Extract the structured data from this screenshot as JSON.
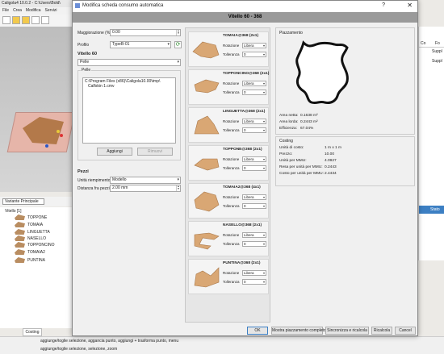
{
  "bg_app": {
    "title": "Caligola4 10.0.2 - C:\\Users\\Bold\\",
    "menu": [
      "File",
      "Crea",
      "Modifica",
      "Servizi"
    ],
    "variant_select": "Variante Principale",
    "tree_root": "Vitello [1]",
    "tree_items": [
      "TOPPONE",
      "TOMAIA",
      "LINGUETTA",
      "NASELLO",
      "TOPPONCINO",
      "TOMAIA2",
      "PUNTINA"
    ],
    "bottom_tab": "Costing",
    "status_lines": [
      "aggiunge/toglie selezione,  aggancia punto,  aggiungi + trasforma punto,  menu",
      "aggiunge/toglie selezione,  selezione,  zoom"
    ],
    "right_panel": {
      "header_cols": [
        "Co",
        "Fo"
      ],
      "cells": [
        "Suppl",
        "Suppl"
      ],
      "stato": "Stato"
    },
    "colors": {
      "selection_blue": "#3c7fc3",
      "leather": "#b3794a"
    }
  },
  "dialog": {
    "title": "Modifica scheda consumo automatica",
    "help": "?",
    "close": "✕",
    "header": "Vitello 60 - 368",
    "maggiorazione_label": "Maggiorazione (%):",
    "maggiorazione_value": "0.00",
    "profilo_label": "Profilo",
    "profilo_value": "TypeB-01",
    "material_section": "Vitello 60",
    "pelle_select": "Pelle",
    "pelle_group": "Pelle",
    "pelle_list": [
      "C:\\Program Files (x86)\\Caligola10.00\\tmp\\",
      "Calfskin 1.cmv"
    ],
    "aggiungi": "Aggiungi",
    "rimuovi": "Rimuovi",
    "pezzi_section": "Pezzi",
    "unita_label": "Unità riempimento",
    "unita_value": "Modello",
    "distanza_label": "Distanza fra pezzi",
    "distanza_value": "2.00 mm",
    "pieces": [
      {
        "name": "TOMAIA@368 (2x1)",
        "rotazione": "Libera",
        "tolleranza": "0"
      },
      {
        "name": "TOPPONCINO@368 (2x1)",
        "rotazione": "Libera",
        "tolleranza": "0"
      },
      {
        "name": "LINGUETTA@368 (2x1)",
        "rotazione": "Libera",
        "tolleranza": "0"
      },
      {
        "name": "TOPPONE@368 (2x1)",
        "rotazione": "Libera",
        "tolleranza": "0"
      },
      {
        "name": "TOMAIA2@368 (4x1)",
        "rotazione": "Libera",
        "tolleranza": "0"
      },
      {
        "name": "NASELLO@368 (2x1)",
        "rotazione": "Libera",
        "tolleranza": "0"
      },
      {
        "name": "PUNTINA@368 (2x1)",
        "rotazione": "Libera",
        "tolleranza": "0"
      }
    ],
    "rotazione_label": "Rotazione",
    "tolleranza_label": "Tolleranza",
    "piazzamento_title": "Piazzamento",
    "area_netta_label": "Area netta:",
    "area_netta_value": "0.1638 m²",
    "area_lorda_label": "Area lorda:",
    "area_lorda_value": "0.2443 m²",
    "efficienza_label": "Efficienza:",
    "efficienza_value": "67.04%",
    "costing_title": "Costing",
    "costing": [
      {
        "label": "Unità di costo:",
        "value": "1 m x 1 m"
      },
      {
        "label": "Prezzo:",
        "value": "10.00"
      },
      {
        "label": "Unità per MMU:",
        "value": "4.0927"
      },
      {
        "label": "Resa per unità per MMU:",
        "value": "0.2443"
      },
      {
        "label": "Costo per unità per MMU:",
        "value": "2.4434"
      }
    ],
    "footer": {
      "ok": "OK",
      "mostra": "Mostra piazzamento completo",
      "sincronizza": "Sincronizza e ricalcola",
      "ricalcola": "Ricalcola",
      "cancel": "Cancel"
    }
  }
}
